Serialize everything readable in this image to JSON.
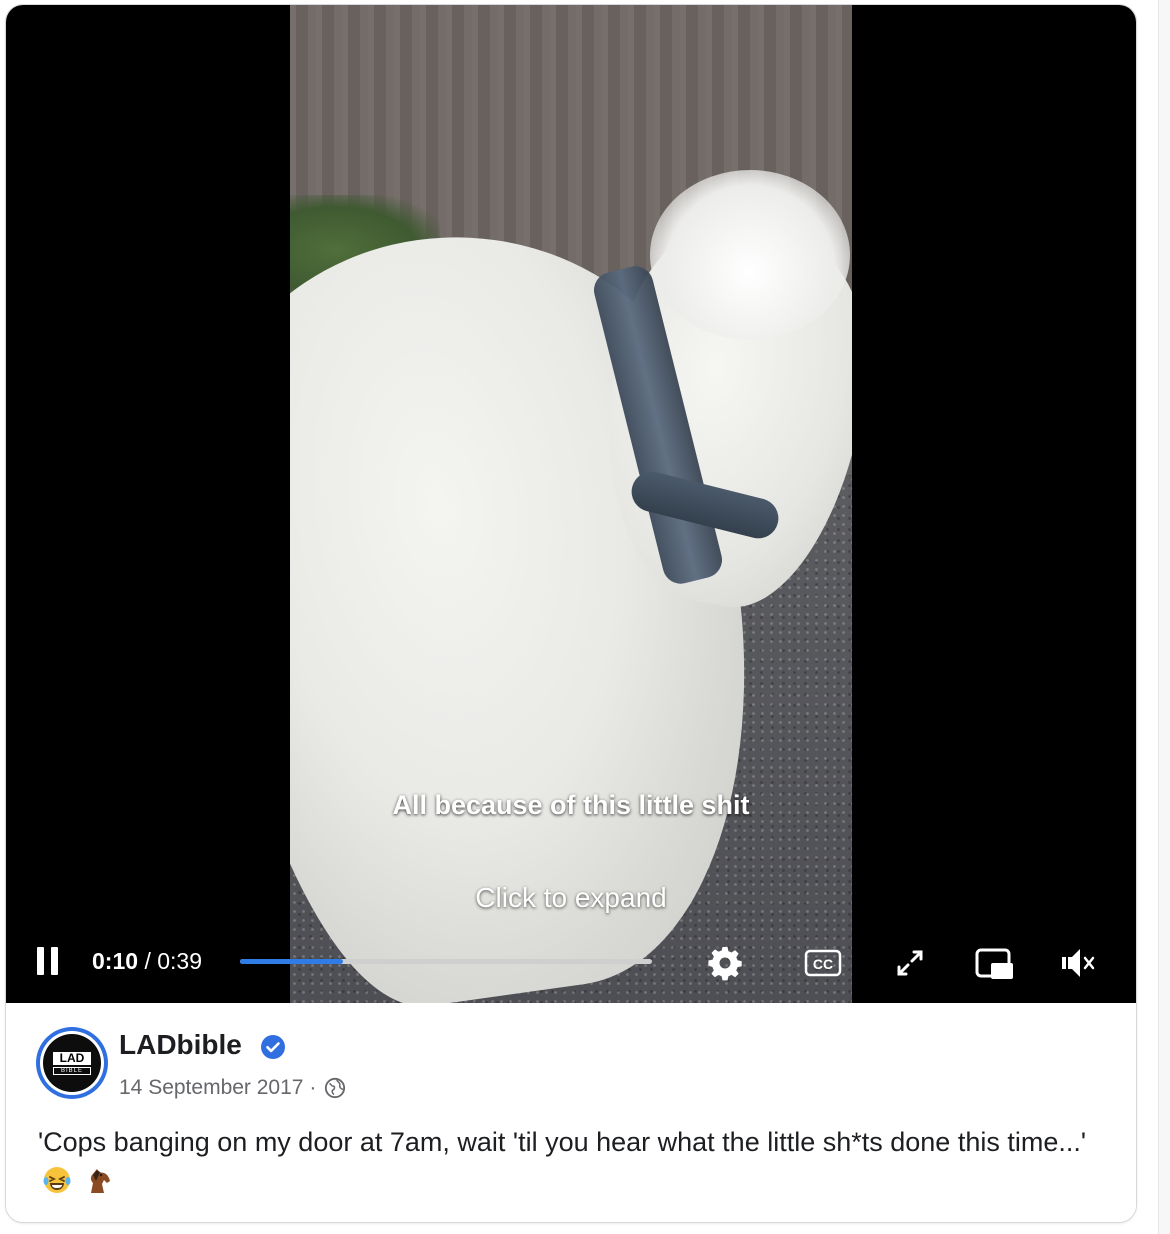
{
  "video": {
    "subtitle": "All because of this little shit",
    "expand_hint": "Click to expand",
    "current_time": "0:10",
    "separator": "/",
    "duration": "0:39",
    "progress": 0.25,
    "progress_color": "#2f7ce6",
    "controls": {
      "pause": "pause-icon",
      "settings": "gear-icon",
      "captions": "CC",
      "fullscreen": "expand-icon",
      "pip": "picture-in-picture-icon",
      "mute": "muted-speaker-icon"
    }
  },
  "post": {
    "page_name": "LADbible",
    "verified": true,
    "date": "14 September 2017",
    "dot": "·",
    "privacy_icon": "globe-icon",
    "caption": "'Cops banging on my door at 7am, wait 'til you hear what the little sh*ts done this time...'",
    "emojis": [
      "laughing-tears-emoji",
      "horse-emoji"
    ],
    "avatar": {
      "logo_top": "LAD",
      "logo_bottom": "BIBLE"
    },
    "accent": "#2f6fe0"
  }
}
